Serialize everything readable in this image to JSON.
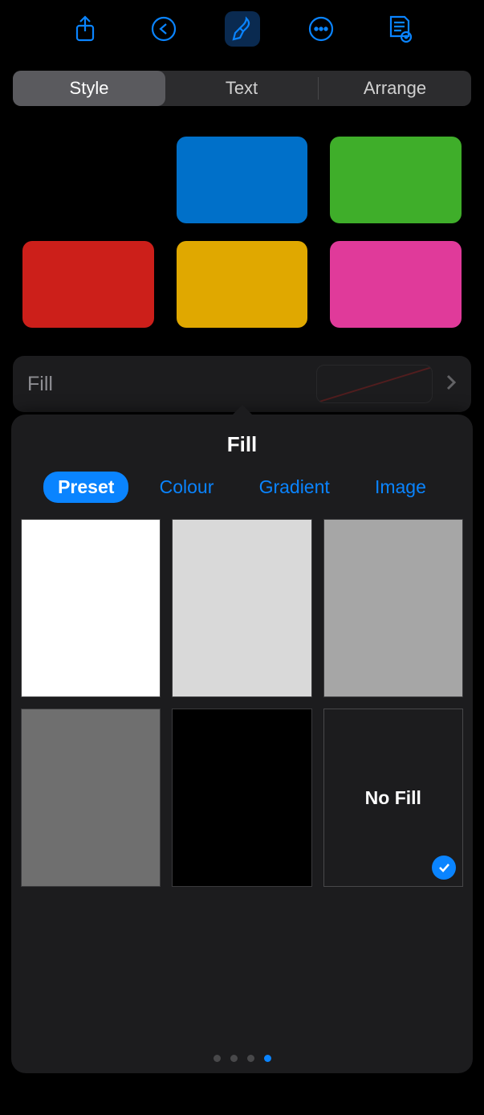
{
  "toolbar": {
    "icons": [
      "share-icon",
      "undo-icon",
      "format-brush-icon",
      "more-icon",
      "presenter-notes-icon"
    ],
    "active_index": 2
  },
  "segmented": {
    "tabs": [
      "Style",
      "Text",
      "Arrange"
    ],
    "active_index": 0
  },
  "style_swatches": [
    {
      "color": "#000000"
    },
    {
      "color": "#0070c9"
    },
    {
      "color": "#3fae2a"
    },
    {
      "color": "#cc1f1a"
    },
    {
      "color": "#e0a800"
    },
    {
      "color": "#e03a9a"
    }
  ],
  "fill_section": {
    "label": "Fill"
  },
  "popover": {
    "title": "Fill",
    "tabs": [
      "Preset",
      "Colour",
      "Gradient",
      "Image"
    ],
    "active_tab_index": 0,
    "presets": [
      {
        "color": "#ffffff",
        "selected": false
      },
      {
        "color": "#d9d9d9",
        "selected": false
      },
      {
        "color": "#a6a6a6",
        "selected": false
      },
      {
        "color": "#6f6f6f",
        "selected": false
      },
      {
        "color": "#000000",
        "selected": false
      },
      {
        "nofill": true,
        "label": "No Fill",
        "selected": true
      }
    ],
    "page_count": 4,
    "active_page": 3
  }
}
